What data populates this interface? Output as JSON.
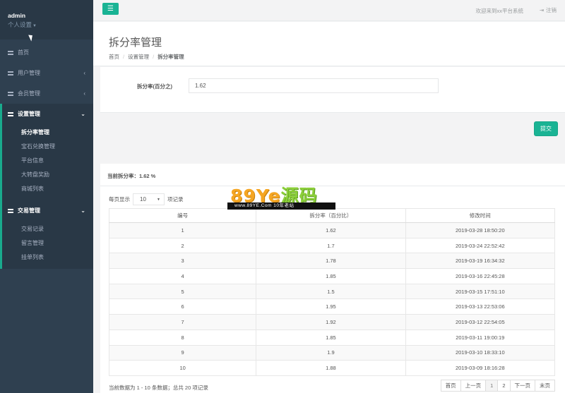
{
  "sidebar": {
    "user": "admin",
    "settings_label": "个人设置",
    "items": [
      {
        "label": "首页"
      },
      {
        "label": "用户管理"
      },
      {
        "label": "会员管理"
      },
      {
        "label": "设置管理"
      },
      {
        "label": "交易管理"
      }
    ],
    "settings_sub": [
      "拆分率管理",
      "宝石兑换管理",
      "平台信息",
      "大转盘奖励",
      "商城列表"
    ],
    "trade_sub": [
      "交易记录",
      "留言管理",
      "挂单列表"
    ]
  },
  "topbar": {
    "menu_icon": "☰",
    "welcome": "欢迎来到xx平台系统",
    "logout_icon": "⇥",
    "logout": "注销"
  },
  "heading": {
    "title": "拆分率管理",
    "crumbs": [
      "首页",
      "设置管理",
      "拆分率管理"
    ]
  },
  "form": {
    "label": "拆分率(百分之)",
    "value": "1.62",
    "submit": "提交"
  },
  "panel": {
    "current_rate": "当前拆分率：1.62 %",
    "pagesize_prefix": "每页显示",
    "pagesize_value": "10",
    "pagesize_suffix": "项记录",
    "columns": [
      "编号",
      "拆分率（百分比）",
      "修改时间"
    ],
    "rows": [
      [
        "1",
        "1.62",
        "2019-03-28 18:50:20"
      ],
      [
        "2",
        "1.7",
        "2019-03-24 22:52:42"
      ],
      [
        "3",
        "1.78",
        "2019-03-19 16:34:32"
      ],
      [
        "4",
        "1.85",
        "2019-03-16 22:45:28"
      ],
      [
        "5",
        "1.5",
        "2019-03-15 17:51:10"
      ],
      [
        "6",
        "1.95",
        "2019-03-13 22:53:06"
      ],
      [
        "7",
        "1.92",
        "2019-03-12 22:54:05"
      ],
      [
        "8",
        "1.85",
        "2019-03-11 19:00:19"
      ],
      [
        "9",
        "1.9",
        "2019-03-10 18:33:10"
      ],
      [
        "10",
        "1.88",
        "2019-03-09 18:16:28"
      ]
    ],
    "info": "当前数据为 1 - 10 条数据；总共 20 项记录",
    "pager": [
      "首页",
      "上一页",
      "1",
      "2",
      "下一页",
      "末页"
    ]
  },
  "watermark": {
    "brand_latin": "89Ye",
    "brand_cn": "源码",
    "url": "www.89YE.Com  10年老站"
  },
  "colors": {
    "sidebar_bg": "#2f4050",
    "accent": "#1ab394"
  }
}
